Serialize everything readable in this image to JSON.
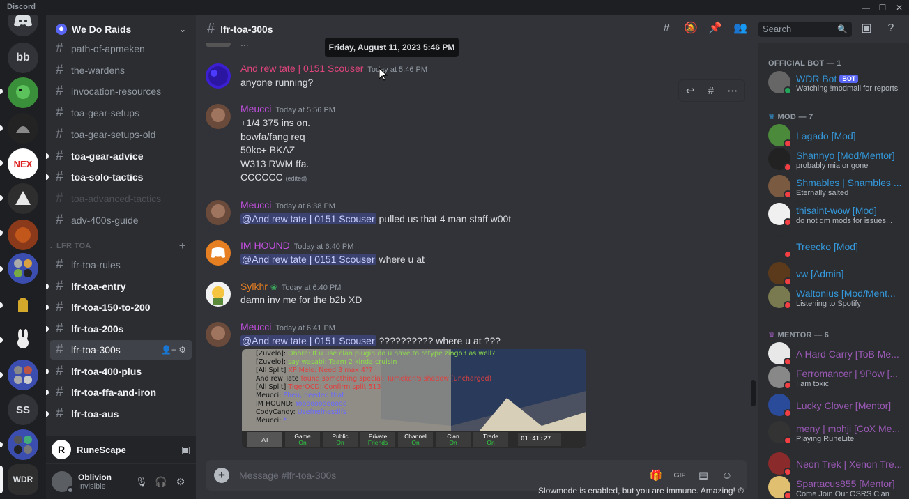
{
  "titlebar": {
    "brand": "Discord"
  },
  "rail": {
    "servers": [
      "bb",
      "SS"
    ]
  },
  "guild": {
    "name": "We Do Raids"
  },
  "channels_top": [
    {
      "name": "path-of-apmeken",
      "state": "normal"
    },
    {
      "name": "the-wardens",
      "state": "normal"
    },
    {
      "name": "invocation-resources",
      "state": "normal"
    },
    {
      "name": "toa-gear-setups",
      "state": "normal"
    },
    {
      "name": "toa-gear-setups-old",
      "state": "normal"
    },
    {
      "name": "toa-gear-advice",
      "state": "unread"
    },
    {
      "name": "toa-solo-tactics",
      "state": "unread"
    },
    {
      "name": "toa-advanced-tactics",
      "state": "muted"
    },
    {
      "name": "adv-400s-guide",
      "state": "normal"
    }
  ],
  "category": {
    "name": "LFR TOA"
  },
  "channels_lfr": [
    {
      "name": "lfr-toa-rules",
      "state": "normal"
    },
    {
      "name": "lfr-toa-entry",
      "state": "unread"
    },
    {
      "name": "lfr-toa-150-to-200",
      "state": "unread"
    },
    {
      "name": "lfr-toa-200s",
      "state": "unread"
    },
    {
      "name": "lfr-toa-300s",
      "state": "selected"
    },
    {
      "name": "lfr-toa-400-plus",
      "state": "unread"
    },
    {
      "name": "lfr-toa-ffa-and-iron",
      "state": "unread"
    },
    {
      "name": "lfr-toa-aus",
      "state": "unread"
    }
  ],
  "activity": {
    "icon": "R",
    "name": "RuneScape"
  },
  "user": {
    "name": "Oblivion",
    "status": "Invisible"
  },
  "chat": {
    "channel": "lfr-toa-300s",
    "tooltip": "Friday, August 11, 2023 5:46 PM",
    "messages": [
      {
        "author": "And rew tate | 0151 Scouser",
        "color": "#e0457b",
        "ts": "Today at 5:46 PM",
        "lines": [
          "anyone running?"
        ]
      },
      {
        "author": "Meucci",
        "color": "#c34fe0",
        "ts": "Today at 5:56 PM",
        "lines": [
          "+1/4 375 ins on.",
          "bowfa/fang req",
          "50kc+ BKAZ",
          "W313 RWM ffa.",
          "CCCCCC"
        ],
        "edited": "(edited)"
      },
      {
        "author": "Meucci",
        "color": "#c34fe0",
        "ts": "Today at 6:38 PM",
        "mention": "@And rew tate | 0151 Scouser",
        "text": "pulled us that 4 man staff w00t"
      },
      {
        "author": "IM HOUND",
        "color": "#c34fe0",
        "ts": "Today at 6:40 PM",
        "mention": "@And rew tate | 0151 Scouser",
        "text": "where u at"
      },
      {
        "author": "Sylkhr",
        "color": "#e67e22",
        "ts": "Today at 6:40 PM",
        "lines": [
          "damn inv me for the b2b XD"
        ]
      },
      {
        "author": "Meucci",
        "color": "#c34fe0",
        "ts": "Today at 6:41 PM",
        "mention": "@And rew tate | 0151 Scouser",
        "text": "?????????? where u at ???"
      }
    ],
    "screenshot": {
      "lines": [
        {
          "name": "[Zuvelo]:",
          "text": "Ohore: If u use clan plugin do u have to retype zingo3 as well?",
          "color": "#8fdc4a"
        },
        {
          "name": "[Zuvelo]:",
          "text": "say wasabi: Team 2 kinda cruisin",
          "color": "#8fdc4a"
        },
        {
          "name": "[All Split]",
          "text": "XP Melo: Need 3 max 4??",
          "color": "#e04040"
        },
        {
          "name": "And rew Tate",
          "text": "found something special: Tumeken's shadow (uncharged)",
          "color": "#e04040"
        },
        {
          "name": "[All Split]",
          "text": "TigerOCD: Confirm split 513",
          "color": "#e04040"
        },
        {
          "name": "Meucci:",
          "text": "Pheu, needed that",
          "color": "#6a6aff"
        },
        {
          "name": "IM HOUND:",
          "text": "Yoooooooooooo",
          "color": "#6a6aff"
        },
        {
          "name": "CodyCandy:",
          "text": "Usefnefnesdlfs",
          "color": "#6a6aff"
        },
        {
          "name": "Meucci:",
          "text": "*",
          "color": "#6a6aff"
        }
      ],
      "tabs": [
        {
          "label": "All",
          "sub": ""
        },
        {
          "label": "Game",
          "sub": "On"
        },
        {
          "label": "Public",
          "sub": "On"
        },
        {
          "label": "Private",
          "sub": "Friends"
        },
        {
          "label": "Channel",
          "sub": "On"
        },
        {
          "label": "Clan",
          "sub": "On"
        },
        {
          "label": "Trade",
          "sub": "On"
        }
      ],
      "timer": "01:41:27"
    },
    "composer_placeholder": "Message #lfr-toa-300s",
    "slowmode": "Slowmode is enabled, but you are immune. Amazing!"
  },
  "header": {
    "search_placeholder": "Search"
  },
  "members": {
    "groups": [
      {
        "label": "OFFICIAL BOT — 1"
      },
      {
        "label": "MOD — 7"
      },
      {
        "label": "MENTOR — 6"
      }
    ],
    "bot": {
      "name": "WDR Bot",
      "tag": "BOT",
      "activity": "Watching !modmail for reports"
    },
    "mods": [
      {
        "name": "Lagado [Mod]",
        "activity": ""
      },
      {
        "name": "Shannyo [Mod/Mentor]",
        "activity": "probably mia or gone"
      },
      {
        "name": "Shmables | Snambles ...",
        "activity": "Eternally salted"
      },
      {
        "name": "thisaint-wow [Mod]",
        "activity": "do not dm mods for issues..."
      },
      {
        "name": "Treecko [Mod]",
        "activity": ""
      },
      {
        "name": "vw [Admin]",
        "activity": ""
      },
      {
        "name": "Waltonius [Mod/Ment...",
        "activity": "Listening to Spotify"
      }
    ],
    "mentors": [
      {
        "name": "A Hard Carry [ToB Me...",
        "activity": ""
      },
      {
        "name": "Ferromancer | 9Pow [...",
        "activity": "I am toxic"
      },
      {
        "name": "Lucky Clover [Mentor]",
        "activity": ""
      },
      {
        "name": "meny | mohji [CoX Me...",
        "activity": "Playing RuneLite"
      },
      {
        "name": "Neon Trek | Xenon Tre...",
        "activity": ""
      },
      {
        "name": "Spartacus855 [Mentor]",
        "activity": "Come Join Our OSRS Clan"
      }
    ],
    "colors": {
      "bot": "#3498db",
      "mod": "#3498db",
      "mentor": "#9b59b6"
    }
  }
}
